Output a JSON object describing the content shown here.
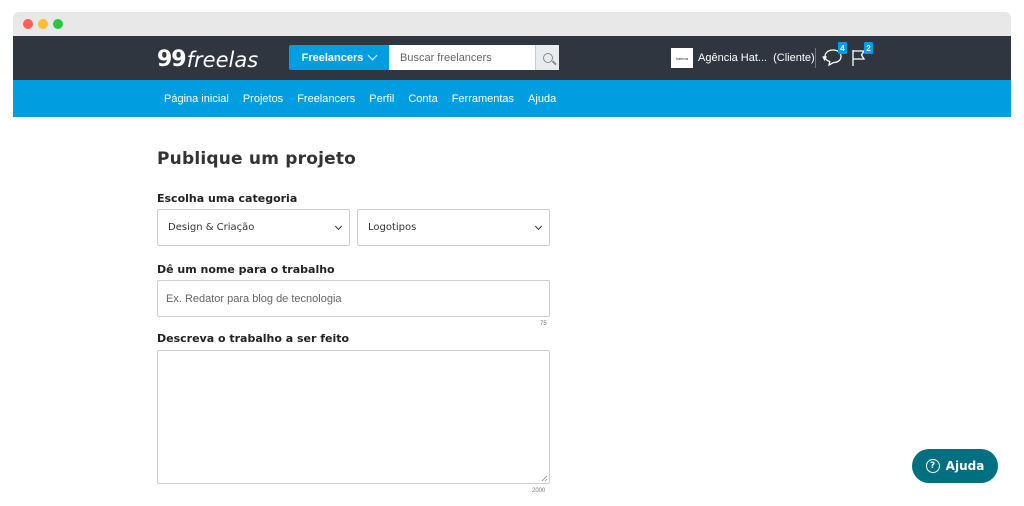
{
  "header": {
    "logo_number": "99",
    "logo_word": "freelas",
    "freelancers_dropdown": "Freelancers",
    "search_placeholder": "Buscar freelancers",
    "account_avatar_text": "hatena",
    "account_name": "Agência Hat...",
    "account_role": "(Cliente)",
    "account_caret": "▼",
    "messages_count": "4",
    "notifications_count": "2"
  },
  "nav": {
    "items": [
      "Página inicial",
      "Projetos",
      "Freelancers",
      "Perfil",
      "Conta",
      "Ferramentas",
      "Ajuda"
    ]
  },
  "form": {
    "title": "Publique um projeto",
    "category_label": "Escolha uma categoria",
    "category_value": "Design & Criação",
    "subcategory_value": "Logotipos",
    "name_label": "Dê um nome para o trabalho",
    "name_placeholder": "Ex. Redator para blog de tecnologia",
    "name_counter": "75",
    "description_label": "Descreva o trabalho a ser feito",
    "description_counter": "2000"
  },
  "help_button": {
    "label": "Ajuda",
    "icon_glyph": "?"
  },
  "colors": {
    "topbar": "#2f3640",
    "navbar": "#009ee0",
    "accent": "#009ee0",
    "help": "#006f80"
  }
}
